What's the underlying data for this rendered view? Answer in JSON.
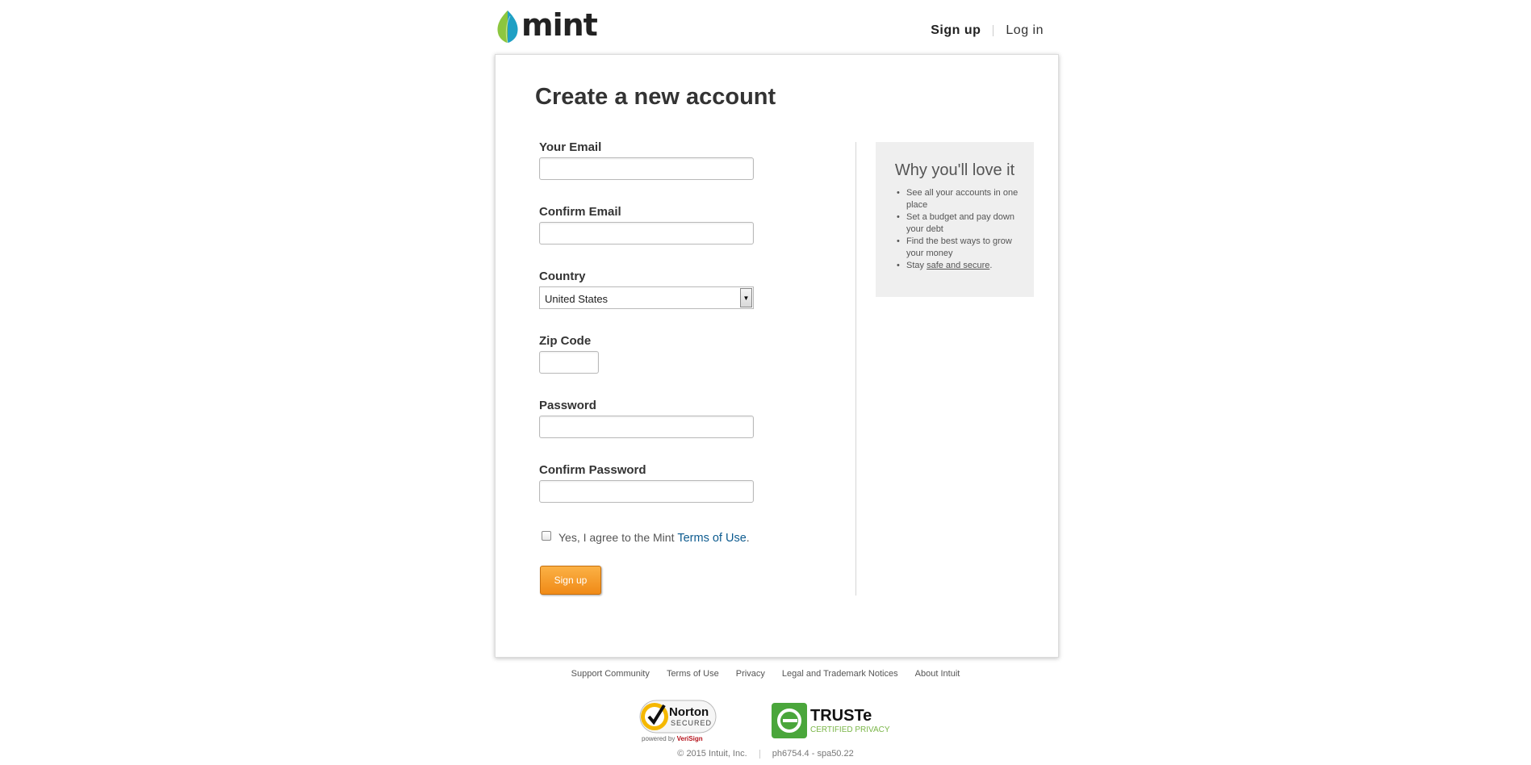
{
  "brand": {
    "name": "mint",
    "leaf_colors": [
      "#8cc63f",
      "#1fa0c4"
    ]
  },
  "nav": {
    "signup": "Sign up",
    "login": "Log in"
  },
  "form": {
    "title": "Create a new account",
    "email_label": "Your Email",
    "confirm_email_label": "Confirm Email",
    "country_label": "Country",
    "country_value": "United States",
    "zip_label": "Zip Code",
    "password_label": "Password",
    "confirm_password_label": "Confirm Password",
    "agree_text": "Yes, I agree to the Mint ",
    "terms_link": "Terms of Use",
    "agree_period": ".",
    "agree_checked": false,
    "submit": "Sign up"
  },
  "why": {
    "title": "Why you'll love it",
    "items": [
      "See all your accounts in one place",
      "Set a budget and pay down your debt",
      "Find the best ways to grow your money"
    ],
    "last_prefix": "Stay ",
    "last_link": "safe and secure",
    "last_suffix": "."
  },
  "footer": {
    "links": [
      "Support Community",
      "Terms of Use",
      "Privacy",
      "Legal and Trademark Notices",
      "About Intuit"
    ],
    "norton": {
      "title": "Norton",
      "subtitle": "SECURED",
      "powered": "powered by ",
      "verisign": "VeriSign"
    },
    "truste": {
      "title": "TRUSTe",
      "subtitle": "CERTIFIED PRIVACY"
    },
    "copyright": "© 2015 Intuit, Inc.",
    "build": "ph6754.4 - spa50.22"
  },
  "colors": {
    "accent_orange": "#f08a17",
    "link_blue": "#0d5b8f",
    "truste_green": "#4aa63b"
  }
}
